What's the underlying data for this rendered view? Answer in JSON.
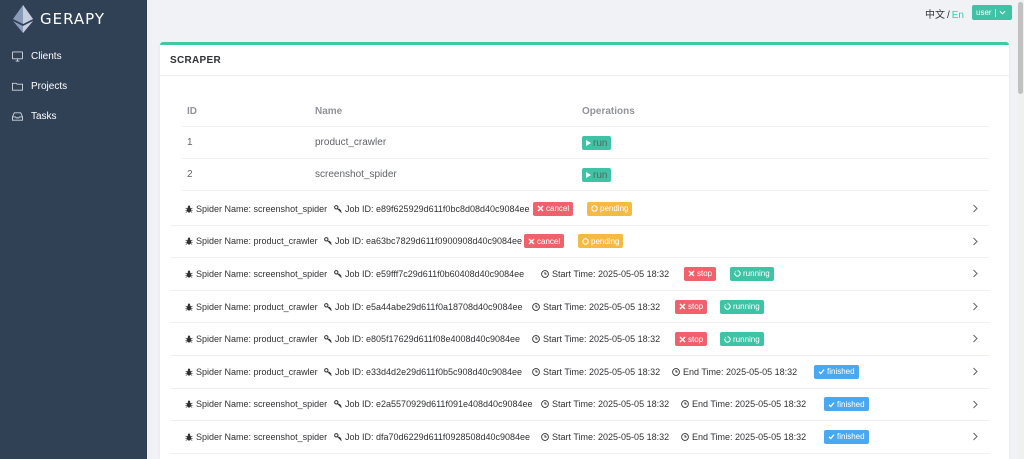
{
  "brand": {
    "name": "GERAPY"
  },
  "sidebar": {
    "items": [
      {
        "label": "Clients",
        "icon": "monitor-icon"
      },
      {
        "label": "Projects",
        "icon": "folder-icon"
      },
      {
        "label": "Tasks",
        "icon": "inbox-icon"
      }
    ]
  },
  "topbar": {
    "lang_zh": "中文",
    "lang_sep": "/",
    "lang_en": "En",
    "user_label": "user"
  },
  "card": {
    "title": "SCRAPER"
  },
  "spiders": {
    "headers": {
      "id": "ID",
      "name": "Name",
      "ops": "Operations"
    },
    "run_label": "run",
    "rows": [
      {
        "id": "1",
        "name": "product_crawler"
      },
      {
        "id": "2",
        "name": "screenshot_spider"
      }
    ]
  },
  "jobs": {
    "labels": {
      "spider": "Spider Name:",
      "job": "Job ID:",
      "start": "Start Time:",
      "end": "End Time:"
    },
    "rows": [
      {
        "spider": "screenshot_spider",
        "job_id": "e89f625929d611f0bc8d08d40c9084ee",
        "action": "cancel",
        "status": "pending"
      },
      {
        "spider": "product_crawler",
        "job_id": "ea63bc7829d611f0900908d40c9084ee",
        "action": "cancel",
        "status": "pending"
      },
      {
        "spider": "screenshot_spider",
        "job_id": "e59fff7c29d611f0b60408d40c9084ee",
        "start": "2025-05-05 18:32",
        "action": "stop",
        "status": "running"
      },
      {
        "spider": "product_crawler",
        "job_id": "e5a44abe29d611f0a18708d40c9084ee",
        "start": "2025-05-05 18:32",
        "action": "stop",
        "status": "running"
      },
      {
        "spider": "product_crawler",
        "job_id": "e805f17629d611f08e4008d40c9084ee",
        "start": "2025-05-05 18:32",
        "action": "stop",
        "status": "running"
      },
      {
        "spider": "product_crawler",
        "job_id": "e33d4d2e29d611f0b5c908d40c9084ee",
        "start": "2025-05-05 18:32",
        "end": "2025-05-05 18:32",
        "status": "finished"
      },
      {
        "spider": "screenshot_spider",
        "job_id": "e2a5570929d611f091e408d40c9084ee",
        "start": "2025-05-05 18:32",
        "end": "2025-05-05 18:32",
        "status": "finished"
      },
      {
        "spider": "screenshot_spider",
        "job_id": "dfa70d6229d611f0928508d40c9084ee",
        "start": "2025-05-05 18:32",
        "end": "2025-05-05 18:32",
        "status": "finished"
      }
    ]
  },
  "colors": {
    "sidebar_bg": "#304156",
    "accent": "#3ec3a5",
    "danger": "#f0616b",
    "warning": "#f5ba42",
    "info": "#4aa8f0"
  }
}
